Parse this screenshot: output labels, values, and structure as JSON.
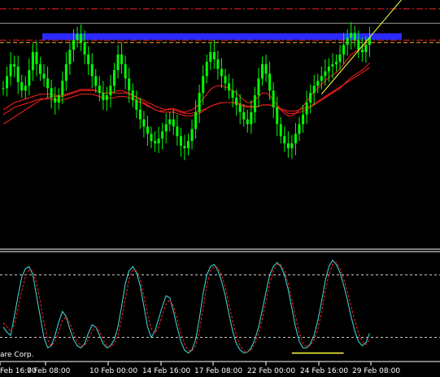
{
  "chart_data": [
    {
      "type": "candlestick",
      "panel": "main",
      "title": "",
      "x_tick_labels": [
        "Feb 16:00",
        "7 Feb 08:00",
        "10 Feb 00:00",
        "14 Feb 16:00",
        "17 Feb 08:00",
        "22 Feb 00:00",
        "24 Feb 16:00",
        "29 Feb 08:00"
      ],
      "bars": 100,
      "close": [
        130,
        140,
        150,
        148,
        135,
        128,
        132,
        145,
        160,
        150,
        142,
        138,
        130,
        122,
        118,
        124,
        136,
        150,
        162,
        170,
        175,
        168,
        158,
        150,
        140,
        132,
        126,
        120,
        124,
        132,
        145,
        158,
        150,
        138,
        128,
        120,
        112,
        104,
        98,
        92,
        86,
        84,
        88,
        94,
        100,
        104,
        98,
        90,
        82,
        80,
        86,
        96,
        110,
        126,
        140,
        152,
        160,
        154,
        146,
        140,
        134,
        128,
        122,
        116,
        110,
        104,
        100,
        110,
        124,
        138,
        150,
        142,
        128,
        114,
        100,
        90,
        84,
        80,
        84,
        92,
        100,
        108,
        118,
        126,
        132,
        136,
        140,
        144,
        148,
        150,
        152,
        158,
        166,
        172,
        176,
        170,
        162,
        160,
        166,
        172
      ],
      "colors": {
        "up": "#00ff00",
        "down": "#00ff00",
        "wick": "#00ff00"
      },
      "moving_averages": [
        {
          "color": "#ff2020",
          "values": [
            108,
            110,
            112,
            114,
            115,
            116,
            117,
            118,
            119,
            120,
            121,
            121,
            121,
            121,
            120,
            120,
            120,
            121,
            122,
            123,
            124,
            125,
            125,
            125,
            125,
            124,
            123,
            122,
            122,
            122,
            122,
            123,
            123,
            123,
            122,
            121,
            120,
            118,
            117,
            115,
            114,
            112,
            111,
            110,
            110,
            110,
            110,
            109,
            108,
            107,
            107,
            107,
            108,
            109,
            111,
            113,
            115,
            116,
            117,
            118,
            118,
            118,
            118,
            117,
            116,
            115,
            114,
            114,
            114,
            115,
            116,
            116,
            116,
            115,
            114,
            112,
            111,
            109,
            109,
            109,
            110,
            111,
            112,
            114,
            116,
            118,
            120,
            122,
            124,
            126,
            128,
            130,
            133,
            136,
            139,
            141,
            143,
            145,
            148,
            151
          ]
        },
        {
          "color": "#ff2020",
          "values": [
            112,
            114,
            116,
            118,
            119,
            120,
            121,
            122,
            123,
            124,
            125,
            125,
            125,
            125,
            124,
            124,
            124,
            125,
            126,
            127,
            128,
            129,
            129,
            129,
            129,
            128,
            127,
            126,
            126,
            126,
            127,
            128,
            128,
            127,
            126,
            124,
            122,
            120,
            118,
            116,
            114,
            112,
            111,
            111,
            112,
            113,
            113,
            112,
            111,
            110,
            111,
            112,
            114,
            117,
            121,
            125,
            129,
            131,
            132,
            132,
            131,
            130,
            128,
            126,
            123,
            120,
            118,
            118,
            120,
            123,
            126,
            126,
            124,
            120,
            116,
            112,
            109,
            107,
            107,
            109,
            112,
            115,
            119,
            123,
            127,
            130,
            133,
            136,
            139,
            141,
            143,
            146,
            150,
            154,
            158,
            160,
            162,
            164,
            167,
            170
          ]
        },
        {
          "color": "#ff2020",
          "values": [
            100,
            102,
            104,
            106,
            108,
            110,
            112,
            114,
            116,
            118,
            120,
            121,
            122,
            123,
            123,
            123,
            123,
            124,
            125,
            126,
            127,
            128,
            128,
            128,
            128,
            128,
            127,
            126,
            126,
            126,
            126,
            126,
            126,
            126,
            125,
            124,
            123,
            121,
            120,
            118,
            117,
            115,
            114,
            113,
            112,
            112,
            112,
            111,
            110,
            109,
            109,
            109,
            110,
            111,
            112,
            113,
            115,
            116,
            117,
            118,
            118,
            118,
            118,
            118,
            117,
            116,
            115,
            115,
            115,
            115,
            116,
            116,
            116,
            115,
            114,
            113,
            112,
            111,
            111,
            111,
            112,
            113,
            114,
            115,
            117,
            119,
            121,
            123,
            125,
            127,
            129,
            131,
            133,
            135,
            137,
            139,
            141,
            143,
            145,
            147
          ]
        }
      ],
      "horizontal_lines": [
        {
          "value": 196,
          "color": "#ff2020",
          "style": "dash-dot"
        },
        {
          "value": 184,
          "color": "#9a9a9a",
          "style": "solid"
        },
        {
          "value": 170,
          "color": "#ff2020",
          "style": "dash-dot"
        },
        {
          "value": 168,
          "color": "#ffb030",
          "style": "dash"
        }
      ],
      "zone": {
        "value": 173,
        "color": "#2a2aff",
        "x_from_bar": 30,
        "x_to_bar": 120
      },
      "trendlines": [
        {
          "color": "#ffff40",
          "from": [
            86,
            125
          ],
          "to": [
            108,
            205
          ]
        }
      ],
      "ylim": [
        0,
        200
      ]
    },
    {
      "type": "line",
      "panel": "stochastic",
      "series": [
        {
          "color": "#40e0e0",
          "style": "solid",
          "values": [
            30,
            25,
            22,
            40,
            60,
            78,
            86,
            88,
            80,
            60,
            40,
            20,
            10,
            12,
            22,
            35,
            45,
            40,
            28,
            18,
            12,
            10,
            14,
            24,
            32,
            30,
            22,
            14,
            10,
            12,
            18,
            30,
            50,
            72,
            84,
            88,
            82,
            70,
            50,
            30,
            20,
            26,
            38,
            50,
            60,
            58,
            45,
            30,
            16,
            8,
            5,
            8,
            18,
            38,
            62,
            80,
            88,
            90,
            84,
            74,
            60,
            42,
            26,
            14,
            8,
            5,
            6,
            10,
            18,
            30,
            46,
            64,
            80,
            88,
            92,
            88,
            80,
            66,
            48,
            30,
            16,
            10,
            10,
            14,
            22,
            36,
            54,
            74,
            88,
            94,
            90,
            82,
            70,
            56,
            40,
            26,
            16,
            12,
            15,
            24
          ]
        },
        {
          "color": "#ff2020",
          "style": "dash",
          "values": [
            34,
            30,
            26,
            32,
            48,
            65,
            78,
            85,
            84,
            72,
            55,
            34,
            18,
            12,
            16,
            26,
            36,
            40,
            34,
            24,
            16,
            12,
            12,
            18,
            26,
            30,
            26,
            18,
            12,
            11,
            14,
            22,
            38,
            58,
            76,
            85,
            84,
            76,
            60,
            42,
            28,
            24,
            30,
            42,
            52,
            56,
            50,
            38,
            24,
            14,
            8,
            7,
            12,
            26,
            48,
            70,
            84,
            88,
            87,
            80,
            68,
            52,
            36,
            22,
            12,
            7,
            6,
            8,
            14,
            24,
            38,
            55,
            72,
            84,
            90,
            90,
            84,
            72,
            56,
            40,
            24,
            14,
            11,
            12,
            18,
            28,
            44,
            64,
            80,
            90,
            92,
            86,
            76,
            64,
            50,
            36,
            24,
            16,
            13,
            18
          ]
        }
      ],
      "levels": [
        {
          "value": 80
        },
        {
          "value": 20
        }
      ],
      "annotation_lines": [
        {
          "color": "#ffff40",
          "from_bar": 78,
          "to_bar": 92,
          "value": 5
        }
      ],
      "ylim": [
        0,
        100
      ]
    }
  ],
  "watermark": "are Corp."
}
